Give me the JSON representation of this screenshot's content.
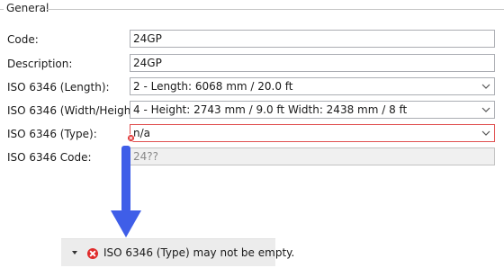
{
  "group": {
    "title": "General"
  },
  "fields": {
    "code": {
      "label": "Code:",
      "value": "24GP"
    },
    "description": {
      "label": "Description:",
      "value": "24GP"
    },
    "length": {
      "label": "ISO 6346 (Length):",
      "value": "2 - Length:  6068 mm / 20.0 ft"
    },
    "width_height": {
      "label": "ISO 6346 (Width/Height):",
      "value": "4 - Height:  2743 mm /  9.0 ft  Width:  2438 mm / 8 ft"
    },
    "type": {
      "label": "ISO 6346 (Type):",
      "value": "n/a"
    },
    "iso_code": {
      "label": "ISO 6346 Code:",
      "value": "24??"
    }
  },
  "error_panel": {
    "message": "ISO 6346 (Type) may not be empty."
  },
  "colors": {
    "error": "#e02b2b",
    "arrow": "#3f5ee8",
    "panel_bg": "#ececec"
  },
  "icons": {
    "dropdown": "chevron-down-icon",
    "field_error": "error-icon",
    "panel_error": "error-circle-icon",
    "expand": "expand-triangle-icon",
    "callout": "arrow-down-icon"
  }
}
